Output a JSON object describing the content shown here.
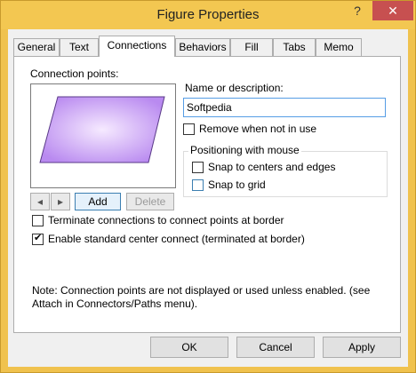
{
  "window": {
    "title": "Figure Properties",
    "help_glyph": "?",
    "close_glyph": "✕"
  },
  "tabs": [
    {
      "label": "General"
    },
    {
      "label": "Text"
    },
    {
      "label": "Connections"
    },
    {
      "label": "Behaviors"
    },
    {
      "label": "Fill"
    },
    {
      "label": "Tabs"
    },
    {
      "label": "Memo"
    }
  ],
  "connections": {
    "points_label": "Connection points:",
    "prev_glyph": "◂",
    "next_glyph": "▸",
    "add_label": "Add",
    "delete_label": "Delete",
    "name_label": "Name or description:",
    "name_value": "Softpedia",
    "remove_label": "Remove when not in use",
    "positioning_title": "Positioning with mouse",
    "snap_centers_label": "Snap to centers and edges",
    "snap_grid_label": "Snap to grid",
    "terminate_label": "Terminate connections to connect points at border",
    "enable_center_label": "Enable standard center connect (terminated at border)",
    "enable_center_checked": true,
    "note_line1": "Note: Connection points are not displayed or used unless enabled.  (see",
    "note_line2": "Attach in Connectors/Paths menu)."
  },
  "buttons": {
    "ok": "OK",
    "cancel": "Cancel",
    "apply": "Apply"
  },
  "colors": {
    "titlebar": "#f3c751",
    "close": "#c75050",
    "shape_fill_center": "#f6eaff",
    "shape_fill_edge": "#b98af0"
  }
}
